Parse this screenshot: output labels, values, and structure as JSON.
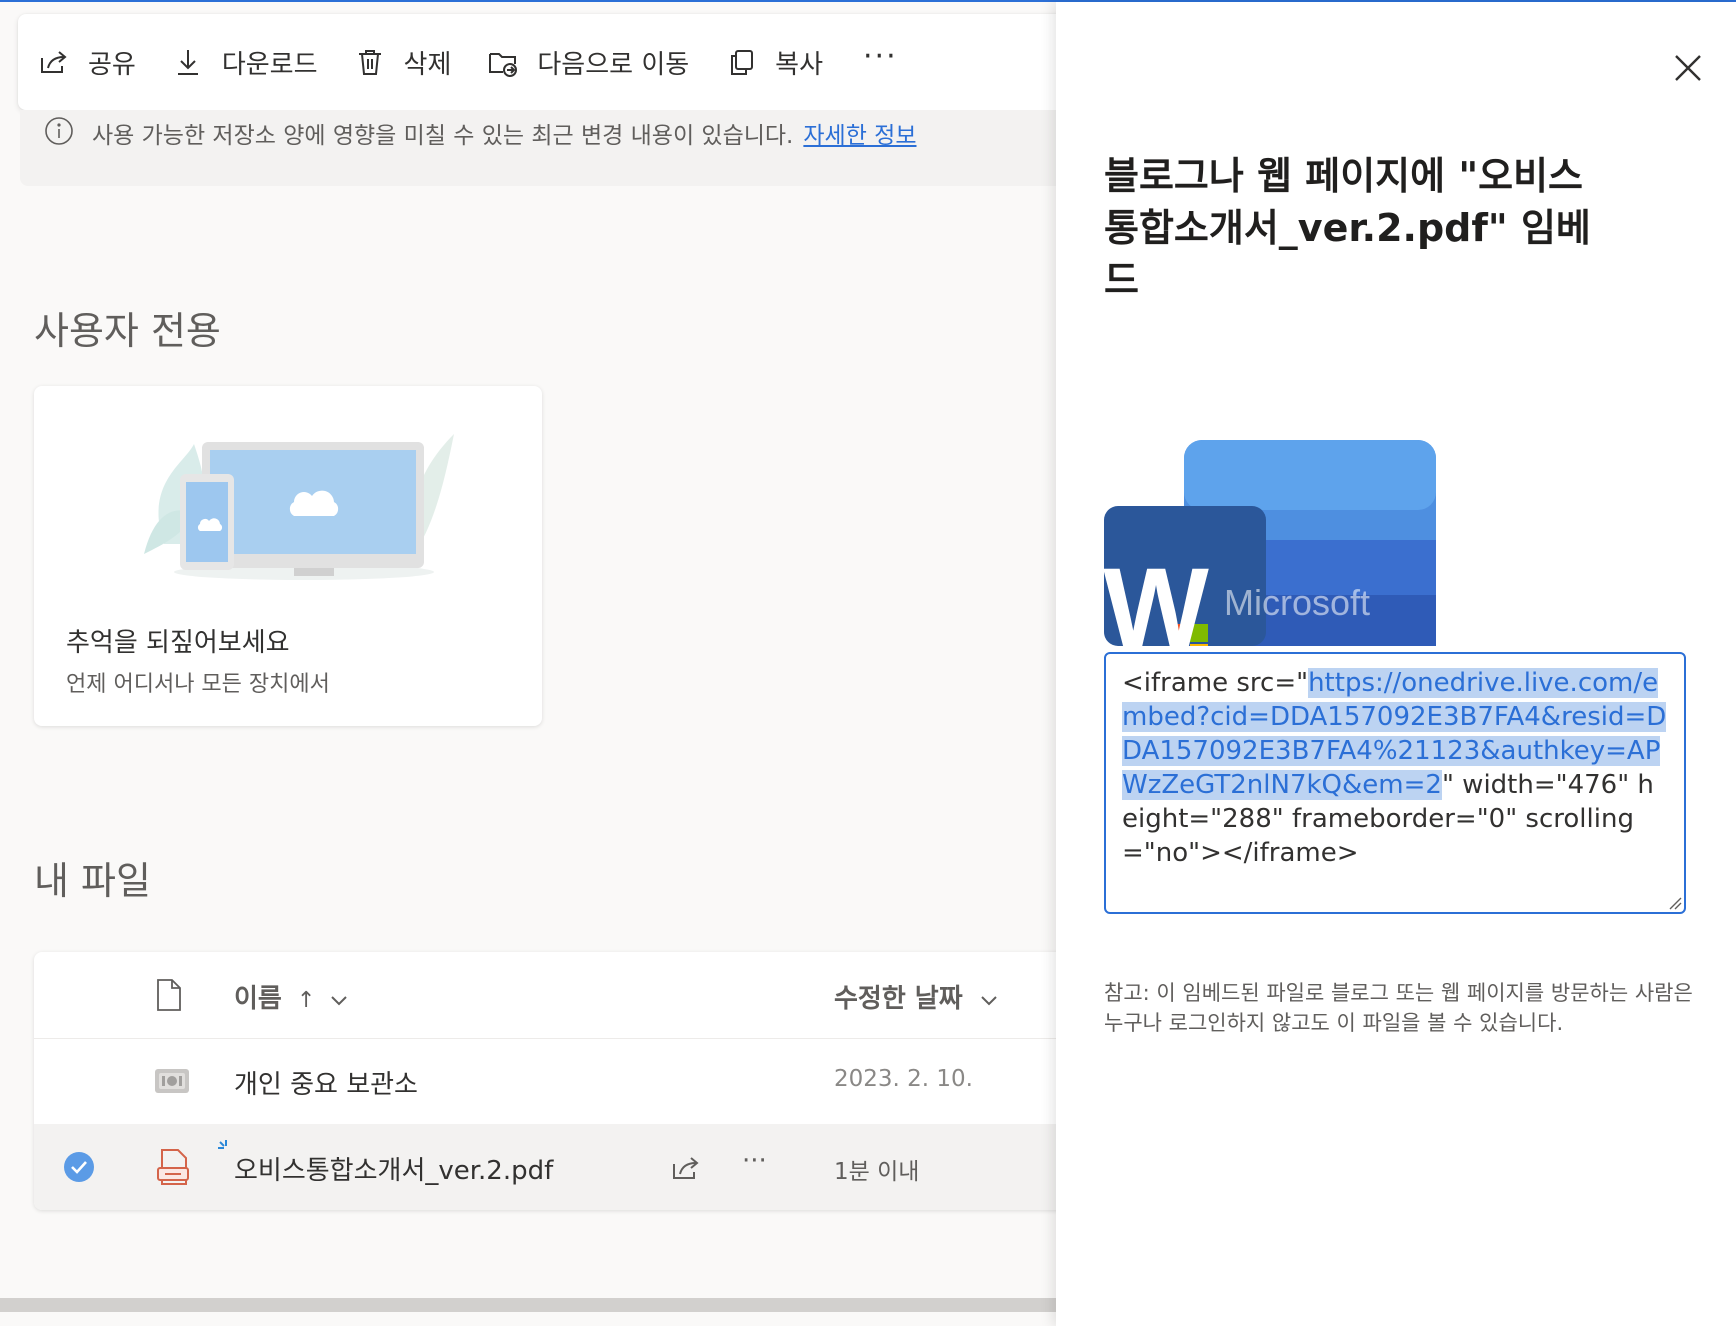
{
  "toolbar": {
    "share": "공유",
    "download": "다운로드",
    "delete": "삭제",
    "move_to": "다음으로 이동",
    "copy": "복사",
    "more": "···"
  },
  "banner": {
    "text": "사용 가능한 저장소 양에 영향을 미칠 수 있는 최근 변경 내용이 있습니다.",
    "link": "자세한 정보"
  },
  "for_you": {
    "title": "사용자 전용",
    "card_title": "추억을 되짚어보세요",
    "card_subtitle": "언제 어디서나 모든 장치에서"
  },
  "my_files": {
    "title": "내 파일",
    "columns": {
      "name": "이름",
      "sort_arrow": "↑",
      "modified": "수정한 날짜"
    },
    "rows": [
      {
        "name": "개인 중요 보관소",
        "modified": "2023. 2. 10.",
        "selected": false
      },
      {
        "name": "오비스통합소개서_ver.2.pdf",
        "modified": "1분 이내",
        "selected": true
      }
    ],
    "row_more": "···"
  },
  "panel": {
    "title": "블로그나 웹 페이지에 \"오비스통합소개서_ver.2.pdf\" 임베드",
    "preview_brand": "Microsoft",
    "preview_letter": "W",
    "embed_code": {
      "prefix": "<iframe src=\"",
      "url": "https://onedrive.live.com/embed?cid=DDA157092E3B7FA4&resid=DDA157092E3B7FA4%21123&authkey=APWzZeGT2nlN7kQ&em=2",
      "suffix": "\" width=\"476\" height=\"288\" frameborder=\"0\" scrolling=\"no\"></iframe>"
    },
    "note": "참고: 이 임베드된 파일로 블로그 또는 웹 페이지를 방문하는 사람은 누구나 로그인하지 않고도 이 파일을 볼 수 있습니다."
  },
  "colors": {
    "accent": "#2b6fd6",
    "selection_highlight": "#bcd3f2",
    "word_blue": "#2b579a"
  }
}
